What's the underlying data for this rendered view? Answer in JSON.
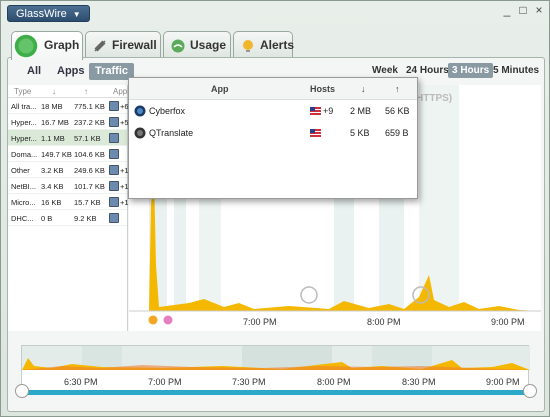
{
  "app": {
    "title": "GlassWire"
  },
  "tabs": [
    {
      "label": "Graph"
    },
    {
      "label": "Firewall"
    },
    {
      "label": "Usage"
    },
    {
      "label": "Alerts"
    }
  ],
  "filters": [
    "All",
    "Apps",
    "Traffic"
  ],
  "time_ranges": [
    "Week",
    "24 Hours",
    "3 Hours",
    "5 Minutes"
  ],
  "left_table": {
    "headers": [
      "Type",
      "↓",
      "↑",
      "App"
    ],
    "rows": [
      {
        "type": "All tra...",
        "down": "18 MB",
        "up": "775.1 KB",
        "extra": "+6"
      },
      {
        "type": "Hyper...",
        "down": "16.7 MB",
        "up": "237.2 KB",
        "extra": "+5"
      },
      {
        "type": "Hyper...",
        "down": "1.1 MB",
        "up": "57.1 KB",
        "extra": ""
      },
      {
        "type": "Doma...",
        "down": "149.7 KB",
        "up": "104.6 KB",
        "extra": ""
      },
      {
        "type": "Other",
        "down": "3.2 KB",
        "up": "249.6 KB",
        "extra": "+1"
      },
      {
        "type": "NetBI...",
        "down": "3.4 KB",
        "up": "101.7 KB",
        "extra": "+1"
      },
      {
        "type": "Micro...",
        "down": "16 KB",
        "up": "15.7 KB",
        "extra": "+1"
      },
      {
        "type": "DHC...",
        "down": "0 B",
        "up": "9.2 KB",
        "extra": ""
      }
    ]
  },
  "popup": {
    "headers": {
      "app": "App",
      "hosts": "Hosts",
      "down": "↓",
      "up": "↑"
    },
    "rows": [
      {
        "app": "Cyberfox",
        "hosts": "+9",
        "down": "2 MB",
        "up": "56 KB"
      },
      {
        "app": "QTranslate",
        "hosts": "",
        "down": "5 KB",
        "up": "659 B"
      }
    ]
  },
  "graph": {
    "partial_label": "HTTPS)",
    "times": [
      "7:00 PM",
      "8:00 PM",
      "9:00 PM"
    ]
  },
  "timeline": {
    "times": [
      "6:30 PM",
      "7:00 PM",
      "7:30 PM",
      "8:00 PM",
      "8:30 PM",
      "9:00 PM"
    ]
  },
  "colors": {
    "accent": "#2aa9c9",
    "traffic": "#f5b800",
    "selected": "#8a9aa3"
  }
}
